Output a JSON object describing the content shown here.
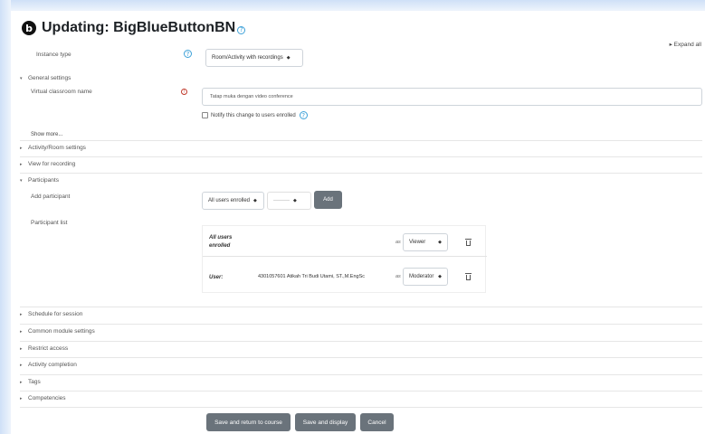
{
  "header": {
    "title": "Updating: BigBlueButtonBN",
    "help_icon": "question-circle-icon",
    "logo_icon": "bigbluebutton-logo-icon"
  },
  "expand_all": "Expand all",
  "instance_type": {
    "label": "Instance type",
    "value": "Room/Activity with recordings"
  },
  "sections": {
    "general": "General settings",
    "activity_room": "Activity/Room settings",
    "view_recording": "View for recording",
    "participants": "Participants",
    "schedule": "Schedule for session",
    "common_module": "Common module settings",
    "restrict_access": "Restrict access",
    "activity_completion": "Activity completion",
    "tags": "Tags",
    "competencies": "Competencies"
  },
  "general": {
    "name_label": "Virtual classroom name",
    "name_value": "Tatap muka dengan video conference",
    "notify_label": "Notify this change to users enrolled",
    "show_more": "Show more..."
  },
  "participants": {
    "add_label": "Add participant",
    "add_select": "All users enrolled",
    "add_select_2": "---------",
    "add_button": "Add",
    "list_label": "Participant list",
    "rows": [
      {
        "type": "All users enrolled",
        "name": "",
        "as": "as",
        "role": "Viewer"
      },
      {
        "type": "User:",
        "name": "4301057601 Atikah Tri Budi Utami, ST.,M.EngSc",
        "as": "as",
        "role": "Moderator"
      }
    ]
  },
  "footer": {
    "save_return": "Save and return to course",
    "save_display": "Save and display",
    "cancel": "Cancel"
  },
  "colors": {
    "button_bg": "#6a737b",
    "help_blue": "#3da1d8",
    "required_red": "#c0392b"
  }
}
